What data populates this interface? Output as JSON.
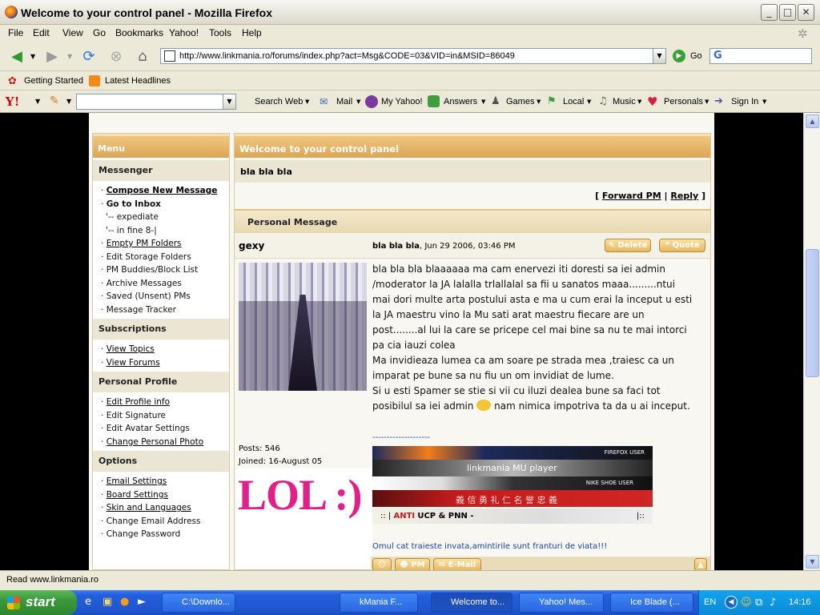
{
  "window": {
    "title": "Welcome to your control panel - Mozilla Firefox"
  },
  "menubar": [
    "File",
    "Edit",
    "View",
    "Go",
    "Bookmarks",
    "Yahoo!",
    "Tools",
    "Help"
  ],
  "navbar": {
    "url": "http://www.linkmania.ro/forums/index.php?act=Msg&CODE=03&VID=in&MSID=86049",
    "go_label": "Go",
    "search_engine_icon": "google-icon"
  },
  "bookmarks": [
    "Getting Started",
    "Latest Headlines"
  ],
  "yahoo_toolbar": {
    "logo": "Y!",
    "items": [
      "Search Web",
      "Mail",
      "My Yahoo!",
      "Answers",
      "Games",
      "Local",
      "Music",
      "Personals",
      "Sign In"
    ]
  },
  "sidebar": {
    "header": "Menu",
    "sections": [
      {
        "title": "Messenger",
        "items": [
          {
            "label": "Compose New Message",
            "style": "bold-link"
          },
          {
            "label": "Go to Inbox",
            "style": "bold"
          },
          {
            "label": "'-- expediate",
            "style": "plain"
          },
          {
            "label": "'-- in fine 8-|",
            "style": "plain"
          },
          {
            "label": "Empty PM Folders",
            "style": "link"
          },
          {
            "label": "Edit Storage Folders",
            "style": "plain"
          },
          {
            "label": "PM Buddies/Block List",
            "style": "plain"
          },
          {
            "label": "Archive Messages",
            "style": "plain"
          },
          {
            "label": "Saved (Unsent) PMs",
            "style": "plain"
          },
          {
            "label": "Message Tracker",
            "style": "plain"
          }
        ]
      },
      {
        "title": "Subscriptions",
        "items": [
          {
            "label": "View Topics",
            "style": "link"
          },
          {
            "label": "View Forums",
            "style": "link"
          }
        ]
      },
      {
        "title": "Personal Profile",
        "items": [
          {
            "label": "Edit Profile info",
            "style": "link"
          },
          {
            "label": "Edit Signature",
            "style": "plain"
          },
          {
            "label": "Edit Avatar Settings",
            "style": "plain"
          },
          {
            "label": "Change Personal Photo",
            "style": "link"
          }
        ]
      },
      {
        "title": "Options",
        "items": [
          {
            "label": "Email Settings",
            "style": "link"
          },
          {
            "label": "Board Settings",
            "style": "link"
          },
          {
            "label": "Skin and Languages",
            "style": "link"
          },
          {
            "label": "Change Email Address",
            "style": "plain"
          },
          {
            "label": "Change Password",
            "style": "plain"
          }
        ]
      }
    ]
  },
  "main": {
    "header": "Welcome to your control panel",
    "subject": "bla bla bla",
    "forward_label": "Forward PM",
    "reply_label": "Reply",
    "pm_header": "Personal Message",
    "author": "gexy",
    "msg_title": "bla bla bla",
    "msg_date": ", Jun 29 2006, 03:46 PM",
    "delete_label": "Delete",
    "quote_label": "Quote",
    "body_lines": [
      "bla bla bla blaaaaaa ma cam enervezi iti doresti sa iei admin",
      "/moderator la JA lalalla trlallalal sa fii u sanatos maaa.........ntui",
      "mai dori multe arta postului asta e ma u cum erai la inceput u esti",
      "la JA maestru vino la Mu sati arat maestru fiecare are un",
      "post........al lui la care se pricepe cel mai bine sa nu te mai intorci",
      "pa cia iauzi colea",
      "Ma invidieaza lumea ca am soare pe strada mea ,traiesc ca un",
      "imparat pe bune sa nu fiu un om invidiat de lume.",
      "Si u esti Spamer se stie si vii cu iluzi dealea bune sa faci tot",
      "posibilul sa iei admin",
      "nam nimica impotriva ta da u ai inceput."
    ],
    "posts_label": "Posts: 546",
    "joined_label": "Joined: 16-August 05",
    "lol_text": "LOL :)",
    "signature_rule": "--------------------",
    "sig_banner_1": "FIREFOX USER",
    "sig_banner_2": "linkmania MU player",
    "sig_banner_3": "NIKE SHOE USER",
    "sig_banner_4": "義 信 勇 礼 仁 名 誉 忠 義",
    "sig_line_prefix": ":: |",
    "sig_anti": "ANTI",
    "sig_ucp": "UCP & PNN -",
    "sig_line_suffix": "|::",
    "sig_quote": "Omul cat traieste invata,amintirile sunt franturi de viata!!!",
    "pm_btn": "PM",
    "email_btn": "E-Mail"
  },
  "statusbar": {
    "text": "Read www.linkmania.ro"
  },
  "taskbar": {
    "start": "start",
    "tasks": [
      "C:\\Downlo...",
      "kMania F...",
      "Welcome to...",
      "Yahoo! Mes...",
      "Ice Blade (..."
    ],
    "lang": "EN",
    "clock": "14:16"
  },
  "colors": {
    "accent_orange": "#dca555",
    "lol_pink": "#e0218a",
    "link_blue": "#1a3fa8"
  }
}
